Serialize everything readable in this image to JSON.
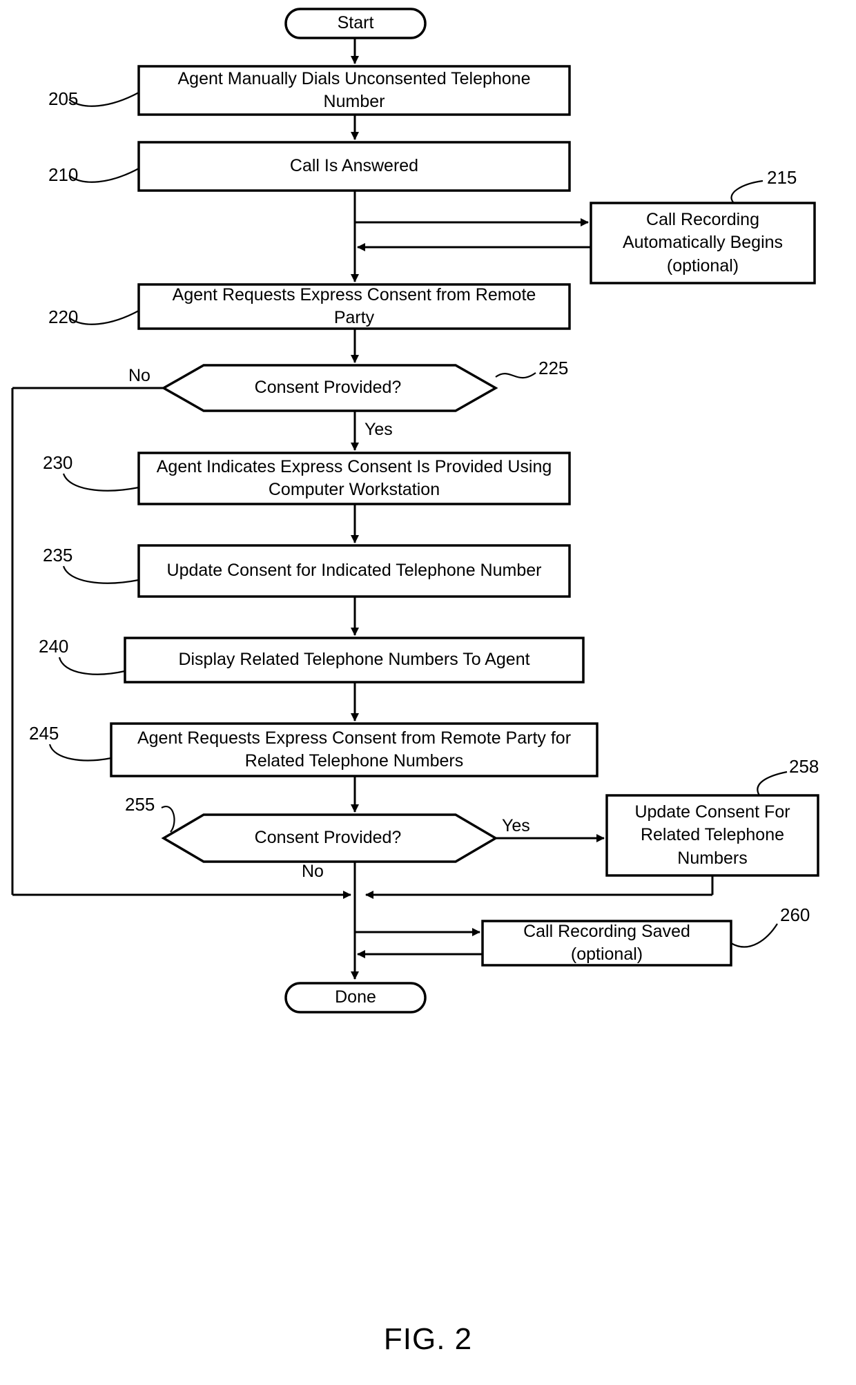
{
  "figure": {
    "caption": "FIG. 2",
    "type": "flowchart",
    "title": ""
  },
  "nodes": [
    {
      "id": "start",
      "ref": "",
      "shape": "terminator",
      "label": "Start"
    },
    {
      "id": "n205",
      "ref": "205",
      "shape": "process",
      "label": "Agent Manually Dials Unconsented Telephone Number"
    },
    {
      "id": "n210",
      "ref": "210",
      "shape": "process",
      "label": "Call Is Answered"
    },
    {
      "id": "n215",
      "ref": "215",
      "shape": "process",
      "label": "Call Recording Automatically Begins (optional)"
    },
    {
      "id": "n220",
      "ref": "220",
      "shape": "process",
      "label": "Agent Requests Express Consent from Remote Party"
    },
    {
      "id": "n225",
      "ref": "225",
      "shape": "decision",
      "label": "Consent Provided?"
    },
    {
      "id": "n230",
      "ref": "230",
      "shape": "process",
      "label": "Agent Indicates Express Consent Is Provided Using Computer Workstation"
    },
    {
      "id": "n235",
      "ref": "235",
      "shape": "process",
      "label": "Update Consent for Indicated Telephone Number"
    },
    {
      "id": "n240",
      "ref": "240",
      "shape": "process",
      "label": "Display Related Telephone Numbers To Agent"
    },
    {
      "id": "n245",
      "ref": "245",
      "shape": "process",
      "label": "Agent Requests Express Consent from Remote Party for Related Telephone Numbers"
    },
    {
      "id": "n255",
      "ref": "255",
      "shape": "decision",
      "label": "Consent Provided?"
    },
    {
      "id": "n258",
      "ref": "258",
      "shape": "process",
      "label": "Update Consent For Related Telephone Numbers"
    },
    {
      "id": "n260",
      "ref": "260",
      "shape": "process",
      "label": "Call Recording Saved (optional)"
    },
    {
      "id": "done",
      "ref": "",
      "shape": "terminator",
      "label": "Done"
    }
  ],
  "edge_labels": {
    "d225_no": "No",
    "d225_yes": "Yes",
    "d255_yes": "Yes",
    "d255_no": "No"
  },
  "style": {
    "stroke": "#000000",
    "fill": "#ffffff",
    "text": "#000000"
  }
}
